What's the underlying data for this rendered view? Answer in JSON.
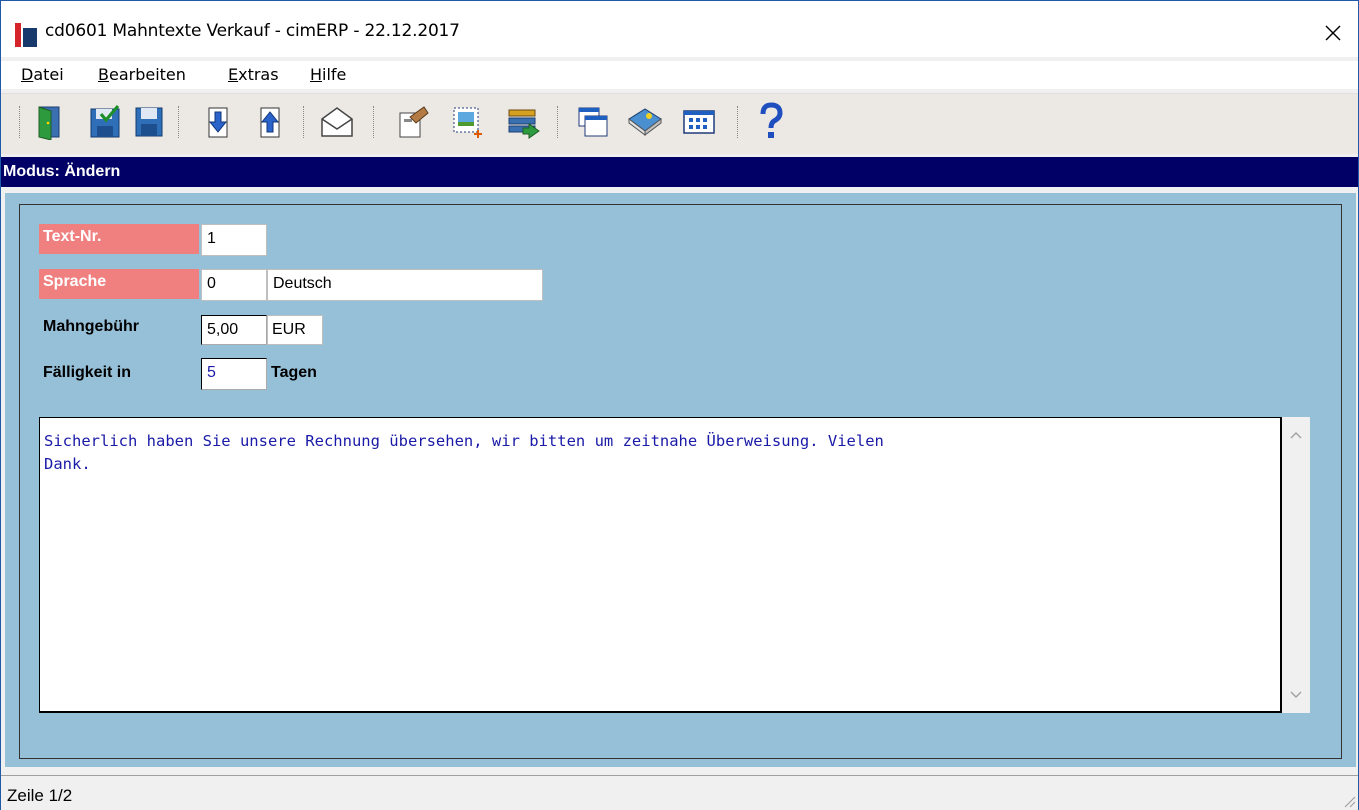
{
  "window": {
    "title": "cd0601 Mahntexte Verkauf - cimERP - 22.12.2017",
    "close_glyph": "✕"
  },
  "menu": {
    "items": [
      {
        "accel": "D",
        "rest": "atei"
      },
      {
        "accel": "B",
        "rest": "earbeiten"
      },
      {
        "accel": "E",
        "rest": "xtras"
      },
      {
        "accel": "H",
        "rest": "ilfe"
      }
    ]
  },
  "toolbar": {
    "icons": [
      "exit-door-icon",
      "save-confirm-icon",
      "save-icon",
      "next-record-icon",
      "previous-record-icon",
      "mail-icon",
      "edit-hand-icon",
      "new-record-icon",
      "transfer-icon",
      "windows-icon",
      "book-icon",
      "grid-icon",
      "help-icon"
    ]
  },
  "mode": {
    "label": "Modus: Ändern"
  },
  "form": {
    "text_nr": {
      "label": "Text-Nr.",
      "value": "1"
    },
    "sprache": {
      "label": "Sprache",
      "code": "0",
      "name": "Deutsch"
    },
    "mahngebuehr": {
      "label": "Mahngebühr",
      "value": "5,00",
      "currency": "EUR"
    },
    "faelligkeit": {
      "label": "Fälligkeit in",
      "value": "5",
      "unit": "Tagen"
    },
    "text": "Sicherlich haben Sie unsere Rechnung übersehen, wir bitten um zeitnahe Überweisung. Vielen\nDank."
  },
  "status": {
    "line": "Zeile 1/2"
  },
  "colors": {
    "mode_bar": "#000066",
    "content_bg": "#96c0d8",
    "required_label": "#f08080",
    "text_blue": "#1a1aa8"
  }
}
